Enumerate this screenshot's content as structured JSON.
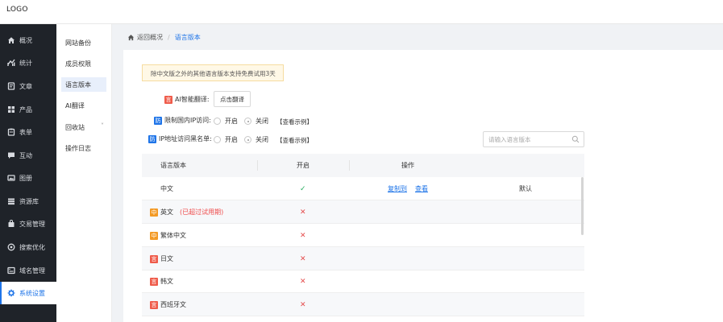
{
  "app": {
    "logo": "LOGO"
  },
  "sidebar": {
    "items": [
      {
        "label": "概况",
        "icon": "home-icon"
      },
      {
        "label": "统计",
        "icon": "stats-icon"
      },
      {
        "label": "文章",
        "icon": "article-icon"
      },
      {
        "label": "产品",
        "icon": "product-icon"
      },
      {
        "label": "表单",
        "icon": "form-icon"
      },
      {
        "label": "互动",
        "icon": "chat-icon"
      },
      {
        "label": "图册",
        "icon": "album-icon"
      },
      {
        "label": "资源库",
        "icon": "resource-icon"
      },
      {
        "label": "交易管理",
        "icon": "trade-icon"
      },
      {
        "label": "搜索优化",
        "icon": "seo-icon"
      },
      {
        "label": "域名管理",
        "icon": "domain-icon"
      },
      {
        "label": "系统设置",
        "icon": "gear-icon",
        "active": true
      }
    ]
  },
  "subnav": {
    "items": [
      {
        "label": "网站备份"
      },
      {
        "label": "成员权限"
      },
      {
        "label": "语言版本",
        "active": true
      },
      {
        "label": "AI翻译"
      },
      {
        "label": "回收站",
        "chevron": "˅"
      },
      {
        "label": "操作日志"
      }
    ]
  },
  "breadcrumb": {
    "back": "返回概况",
    "separator": "/",
    "current": "语言版本"
  },
  "notice": "除中文版之外的其他语言版本支持免费试用3天",
  "ai_translate": {
    "badge": "言",
    "label": "AI智能翻译:",
    "button": "点击翻译"
  },
  "ip_limit": {
    "badge": "防",
    "label": "限制国内IP访问:",
    "options": [
      "开启",
      "关闭"
    ],
    "selected": "关闭",
    "example": "【查看示例】"
  },
  "ip_blacklist": {
    "badge": "防",
    "label": "IP地址访问黑名单:",
    "options": [
      "开启",
      "关闭"
    ],
    "selected": "关闭",
    "example": "【查看示例】"
  },
  "search": {
    "placeholder": "请输入语言版本"
  },
  "table": {
    "headers": [
      "语言版本",
      "开启",
      "操作"
    ],
    "rows": [
      {
        "badge": "",
        "name": "中文",
        "note": "",
        "enabled": true,
        "copy": "复制到",
        "view": "查看",
        "default": "默认"
      },
      {
        "badge": "中",
        "badge_color": "#f39a25",
        "name": "英文",
        "note": "(已超过试用期)",
        "enabled": false
      },
      {
        "badge": "中",
        "badge_color": "#f39a25",
        "name": "繁体中文",
        "note": "",
        "enabled": false
      },
      {
        "badge": "言",
        "badge_color": "#ef5b4a",
        "name": "日文",
        "note": "",
        "enabled": false
      },
      {
        "badge": "言",
        "badge_color": "#ef5b4a",
        "name": "韩文",
        "note": "",
        "enabled": false
      },
      {
        "badge": "言",
        "badge_color": "#ef5b4a",
        "name": "西班牙文",
        "note": "",
        "enabled": false
      }
    ],
    "marks": {
      "on": "✓",
      "off": "✕"
    }
  }
}
